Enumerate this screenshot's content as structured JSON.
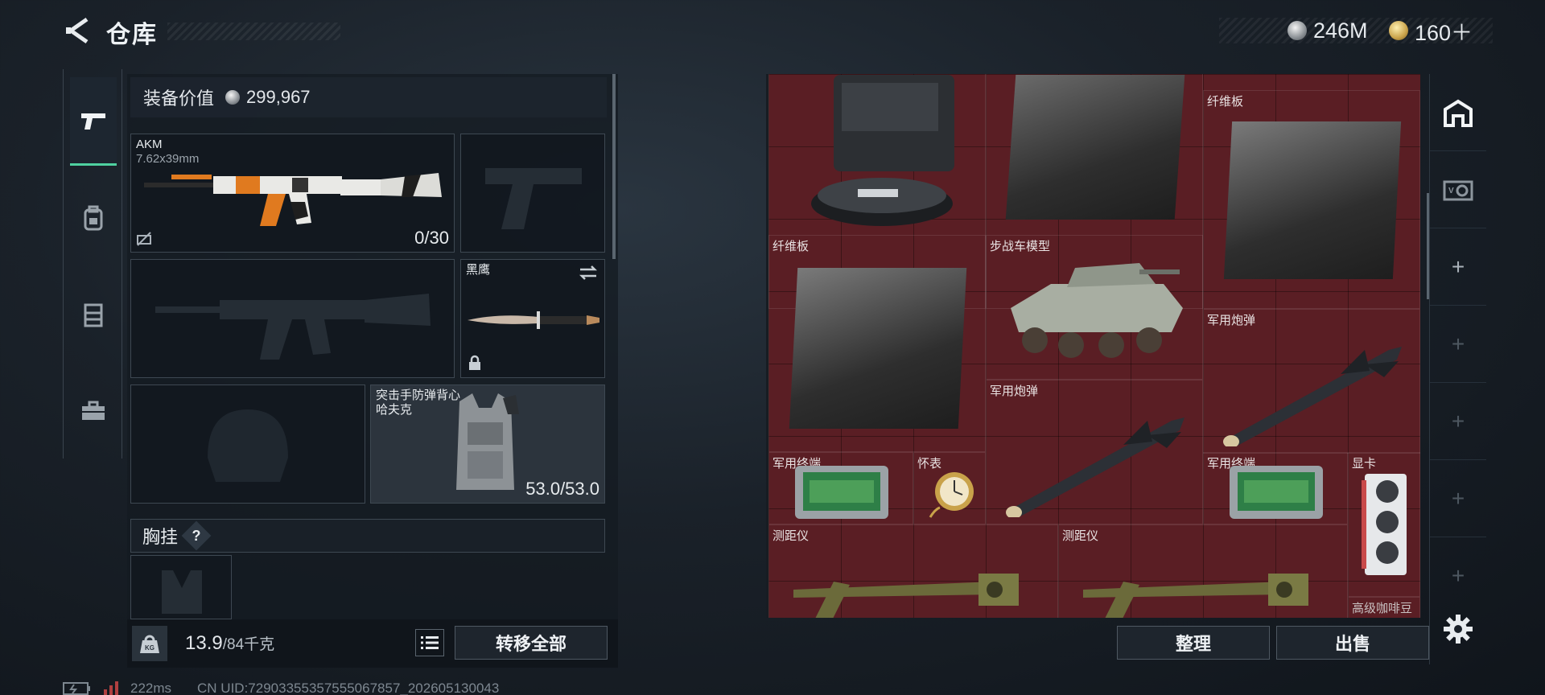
{
  "header": {
    "title": "仓库",
    "currency_silver": "246M",
    "currency_gold": "160＋"
  },
  "left_nav": {
    "tabs": [
      {
        "icon": "pistol-icon",
        "active": true
      },
      {
        "icon": "backpack-icon",
        "active": false
      },
      {
        "icon": "vest-icon",
        "active": false
      },
      {
        "icon": "case-icon",
        "active": false
      }
    ]
  },
  "loadout": {
    "value_label": "装备价值",
    "value": "299,967",
    "primary": {
      "name": "AKM",
      "ammo_type": "7.62x39mm",
      "ammo": "0/30"
    },
    "melee": {
      "name": "黑鹰"
    },
    "armor": {
      "name_line1": "突击手防弹背心",
      "name_line2": "哈夫克",
      "durability": "53.0/53.0"
    },
    "chest_rig_label": "胸挂",
    "chest_help": "?",
    "weight_current": "13.9",
    "weight_max": "/84千克",
    "transfer_all": "转移全部"
  },
  "storage": {
    "items": [
      {
        "label": "",
        "kind": "robot-vacuum"
      },
      {
        "label": "",
        "kind": "fiber-board"
      },
      {
        "label": "纤维板",
        "kind": "fiber-board"
      },
      {
        "label": "纤维板",
        "kind": "fiber-board"
      },
      {
        "label": "步战车模型",
        "kind": "ifv-model"
      },
      {
        "label": "军用炮弹",
        "kind": "missile"
      },
      {
        "label": "军用炮弹",
        "kind": "missile"
      },
      {
        "label": "军用终端",
        "kind": "terminal"
      },
      {
        "label": "怀表",
        "kind": "pocket-watch"
      },
      {
        "label": "军用终端",
        "kind": "terminal"
      },
      {
        "label": "显卡",
        "kind": "gpu"
      },
      {
        "label": "测距仪",
        "kind": "rangefinder"
      },
      {
        "label": "测距仪",
        "kind": "rangefinder"
      },
      {
        "label": "高级咖啡豆",
        "kind": "coffee"
      }
    ],
    "sort_label": "整理",
    "sell_label": "出售"
  },
  "status_bar": {
    "ping": "222ms",
    "uid": "CN UID:72903355357555067857_202605130043"
  },
  "colors": {
    "accent": "#4fd1a0",
    "grid_bg": "#5a1e24",
    "weapon_orange": "#e07a1f"
  }
}
